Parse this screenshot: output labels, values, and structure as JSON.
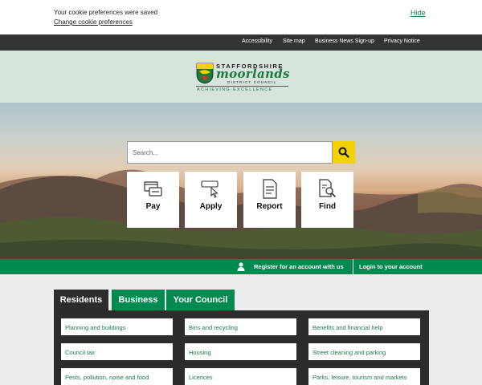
{
  "cookie": {
    "message": "Your cookie preferences were saved",
    "change_label": "Change cookie preferences",
    "hide_label": "Hide"
  },
  "topnav": [
    "Accessibility",
    "Site map",
    "Business News Sign-up",
    "Privacy Notice"
  ],
  "logo": {
    "line1": "STAFFORDSHIRE",
    "line2": "moorlands",
    "line3": "DISTRICT COUNCIL",
    "tagline": "ACHIEVING·EXCELLENCE"
  },
  "search": {
    "placeholder": "Search..."
  },
  "tiles": [
    {
      "label": "Pay",
      "icon": "pay-icon"
    },
    {
      "label": "Apply",
      "icon": "apply-icon"
    },
    {
      "label": "Report",
      "icon": "report-icon"
    },
    {
      "label": "Find",
      "icon": "find-icon"
    }
  ],
  "account": {
    "register_label": "Register for an account with us",
    "login_label": "Login to your account"
  },
  "tabs": [
    "Residents",
    "Business",
    "Your Council"
  ],
  "active_tab": "Residents",
  "links": [
    [
      "Planning and buildings",
      "Bins and recycling",
      "Benefits and financial help"
    ],
    [
      "Council tax",
      "Housing",
      "Street cleaning and parking"
    ],
    [
      "Pests, pollution, noise and food",
      "Licences",
      "Parks, leisure, tourism and markets"
    ]
  ],
  "colors": {
    "brand_green": "#008a4f",
    "accent_yellow": "#f2d200",
    "dark": "#2c2c2c"
  }
}
